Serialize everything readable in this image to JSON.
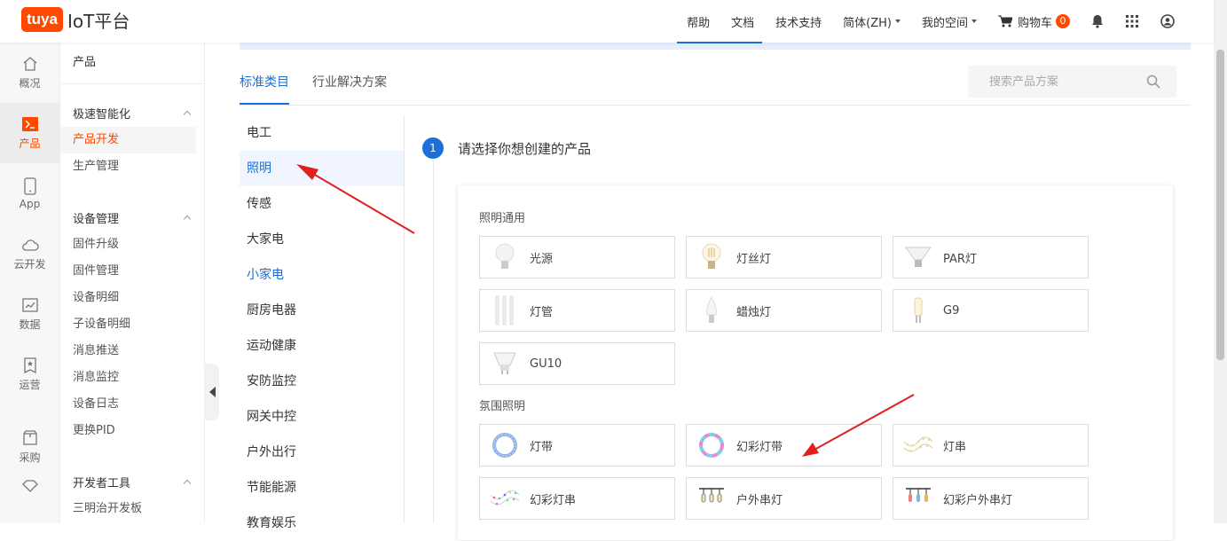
{
  "header": {
    "logo_brand": "tuya",
    "logo_text": "IoT平台",
    "nav": {
      "help": "帮助",
      "docs": "文档",
      "support": "技术支持",
      "language": "简体(ZH)",
      "space": "我的空间",
      "cart": "购物车",
      "cart_count": "0"
    }
  },
  "leftnav": {
    "items": [
      {
        "label": "概况",
        "icon": "home-icon"
      },
      {
        "label": "产品",
        "icon": "product-icon"
      },
      {
        "label": "App",
        "icon": "phone-icon"
      },
      {
        "label": "云开发",
        "icon": "cloud-icon"
      },
      {
        "label": "数据",
        "icon": "chart-icon"
      },
      {
        "label": "运营",
        "icon": "operation-icon"
      },
      {
        "label": "采购",
        "icon": "purchase-icon"
      }
    ]
  },
  "sidebar": {
    "title": "产品",
    "group1": {
      "header": "极速智能化",
      "items": [
        "产品开发",
        "生产管理"
      ]
    },
    "group2": {
      "header": "设备管理",
      "items": [
        "固件升级",
        "固件管理",
        "设备明细",
        "子设备明细",
        "消息推送",
        "消息监控",
        "设备日志",
        "更换PID"
      ]
    },
    "group3": {
      "header": "开发者工具",
      "items": [
        "三明治开发板"
      ]
    }
  },
  "tabs": [
    "标准类目",
    "行业解决方案"
  ],
  "search": {
    "placeholder": "搜索产品方案"
  },
  "categories": [
    "电工",
    "照明",
    "传感",
    "大家电",
    "小家电",
    "厨房电器",
    "运动健康",
    "安防监控",
    "网关中控",
    "户外出行",
    "节能能源",
    "教育娱乐"
  ],
  "step": {
    "number": "1",
    "text": "请选择你想创建的产品"
  },
  "sections": [
    {
      "title": "照明通用",
      "items": [
        "光源",
        "灯丝灯",
        "PAR灯",
        "灯管",
        "蜡烛灯",
        "G9",
        "GU10"
      ]
    },
    {
      "title": "氛围照明",
      "items": [
        "灯带",
        "幻彩灯带",
        "灯串",
        "幻彩灯串",
        "户外串灯",
        "幻彩户外串灯"
      ]
    }
  ],
  "colors": {
    "brand": "#ff4800",
    "accent": "#1a6fd8",
    "annotation": "#e02020"
  }
}
